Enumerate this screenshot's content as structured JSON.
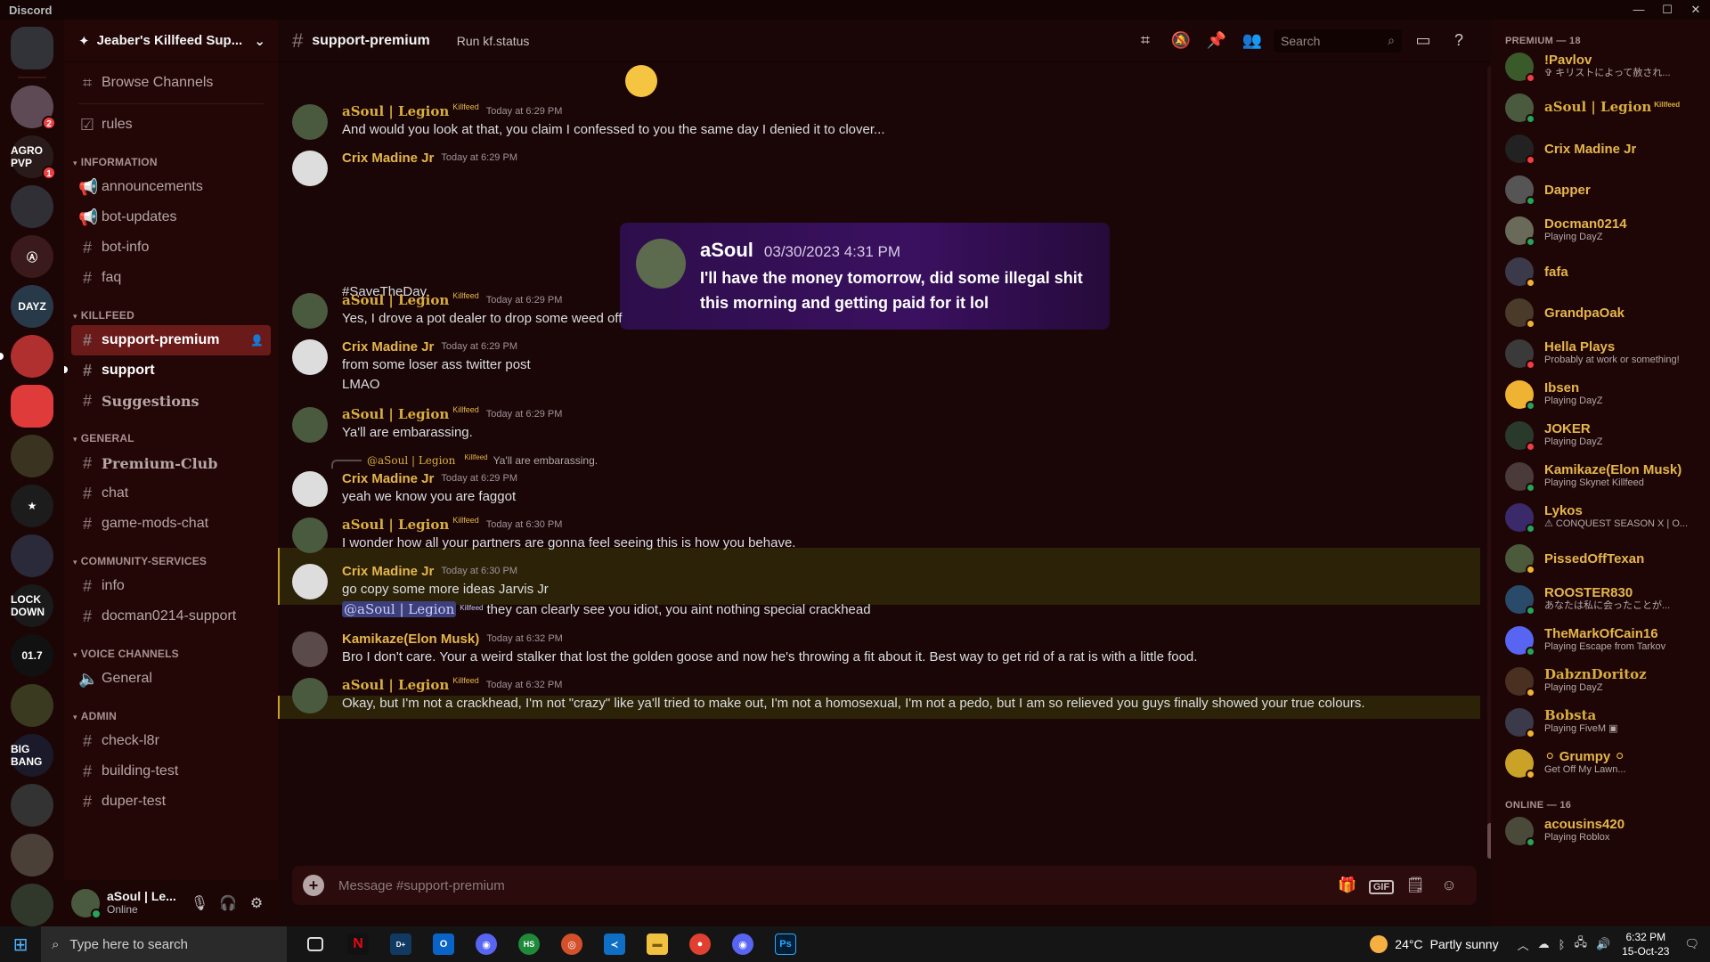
{
  "window": {
    "app_name": "Discord",
    "minimize": "—",
    "maximize": "☐",
    "close": "✕"
  },
  "guilds": [
    {
      "label": "",
      "color": "#313338",
      "kind": "home"
    },
    {
      "label": "",
      "color": "#5d4a54",
      "badge": "2"
    },
    {
      "label": "AGRO PVP",
      "color": "#2a1b1b",
      "badge": "1"
    },
    {
      "label": "",
      "color": "#2f2f35"
    },
    {
      "label": "Ⓐ",
      "color": "#3a1a1a"
    },
    {
      "label": "DAYZ",
      "color": "#283a4a"
    },
    {
      "label": "",
      "color": "#b03030"
    },
    {
      "label": "",
      "color": "#e03b3b",
      "kind": "folder"
    },
    {
      "label": "",
      "color": "#3a3320"
    },
    {
      "label": "★",
      "color": "#1c1c1c"
    },
    {
      "label": "",
      "color": "#2a2a3a"
    },
    {
      "label": "LOCK DOWN",
      "color": "#1a1a1a"
    },
    {
      "label": "01.7",
      "color": "#111"
    },
    {
      "label": "",
      "color": "#3a3a20"
    },
    {
      "label": "BIG BANG",
      "color": "#1a1a2a"
    },
    {
      "label": "",
      "color": "#333"
    },
    {
      "label": "",
      "color": "#4a4038"
    },
    {
      "label": "",
      "color": "#30382c"
    }
  ],
  "server": {
    "name": "Jeaber's Killfeed Sup...",
    "chevron": "⌄"
  },
  "sidebar": {
    "browse": "Browse Channels",
    "rules": "rules",
    "cat_information": "INFORMATION",
    "announcements": "announcements",
    "bot_updates": "bot-updates",
    "bot_info": "bot-info",
    "faq": "faq",
    "cat_killfeed": "KILLFEED",
    "support_premium": "support-premium",
    "support": "support",
    "suggestions": "Suggestions",
    "cat_general": "GENERAL",
    "premium_club": "Premium-Club",
    "chat": "chat",
    "game_mods_chat": "game-mods-chat",
    "cat_community": "COMMUNITY-SERVICES",
    "info": "info",
    "docman_support": "docman0214-support",
    "cat_voice": "VOICE CHANNELS",
    "voice_general": "General",
    "cat_admin": "ADMIN",
    "check_l8r": "check-l8r",
    "building_test": "building-test",
    "duper_test": "duper-test"
  },
  "user_panel": {
    "name": "aSoul | Le...",
    "status": "Online"
  },
  "header": {
    "channel": "support-premium",
    "topic": "Run kf.status",
    "search_placeholder": "Search"
  },
  "messages": [
    {
      "author": "aSoul | Legion",
      "tag": "Killfeed",
      "time": "Today at 6:29 PM",
      "lines": [
        "And would you look at that, you claim I confessed to you the same day I denied it to clover..."
      ]
    },
    {
      "author": "Crix Madine Jr",
      "time": "Today at 6:29 PM",
      "lines": [
        "#SaveTheDay"
      ]
    },
    {
      "author": "aSoul | Legion",
      "tag": "Killfeed",
      "time": "Today at 6:29 PM",
      "lines": [
        "Yes, I drove a pot dealer to drop some weed off"
      ]
    },
    {
      "author": "Crix Madine Jr",
      "time": "Today at 6:29 PM",
      "lines": [
        "from some loser ass twitter post",
        "LMAO"
      ]
    },
    {
      "author": "aSoul | Legion",
      "tag": "Killfeed",
      "time": "Today at 6:29 PM",
      "lines": [
        "Ya'll are embarassing."
      ]
    },
    {
      "author": "Crix Madine Jr",
      "time": "Today at 6:29 PM",
      "lines": [
        "yeah we know you are faggot"
      ],
      "reply_name": "@aSoul | Legion",
      "reply_tag": "Killfeed",
      "reply_text": "Ya'll are embarassing."
    },
    {
      "author": "aSoul | Legion",
      "tag": "Killfeed",
      "time": "Today at 6:30 PM",
      "lines": [
        "I wonder how all your partners are gonna feel seeing this is how you behave."
      ]
    },
    {
      "author": "Crix Madine Jr",
      "time": "Today at 6:30 PM",
      "lines": [
        "go copy some more ideas Jarvis Jr"
      ],
      "mention": "@aSoul | Legion",
      "mention_tag": "Killfeed",
      "mention_text": "they can clearly see you idiot, you aint nothing special crackhead"
    },
    {
      "author": "Kamikaze(Elon Musk)",
      "time": "Today at 6:32 PM",
      "lines": [
        "Bro I don't care. Your a weird stalker that lost the golden goose and now he's throwing a fit about it. Best way to get rid of a rat is with a little food."
      ]
    },
    {
      "author": "aSoul | Legion",
      "tag": "Killfeed",
      "time": "Today at 6:32 PM",
      "lines": [
        "Okay, but I'm not a crackhead, I'm not \"crazy\" like ya'll tried to make out, I'm not a homosexual, I'm not a pedo, but I am so relieved you guys finally showed your true colours."
      ]
    }
  ],
  "embed": {
    "name": "aSoul",
    "time": "03/30/2023 4:31 PM",
    "text": "I'll have the money tomorrow, did some illegal shit this morning and getting paid for it lol"
  },
  "composer": {
    "placeholder": "Message #support-premium",
    "gif": "GIF"
  },
  "members": {
    "premium_header": "PREMIUM — 18",
    "online_header": "ONLINE — 16",
    "premium": [
      {
        "name": "!Pavlov",
        "activity": "✞ キリストによって赦され...",
        "color": "#3a5a2a",
        "status": "#f23f43"
      },
      {
        "name": "aSoul | Legion",
        "tag": "Killfeed",
        "activity": "",
        "color": "#4a5a3e",
        "status": "#23a55a",
        "soul": true
      },
      {
        "name": "Crix Madine Jr",
        "activity": "",
        "color": "#222",
        "status": "#f23f43"
      },
      {
        "name": "Dapper",
        "activity": "",
        "color": "#555",
        "status": "#23a55a"
      },
      {
        "name": "Docman0214",
        "activity": "Playing DayZ",
        "color": "#6a6a5a",
        "status": "#23a55a"
      },
      {
        "name": "fafa",
        "activity": "",
        "color": "#3a3a4a",
        "status": "#f0b232"
      },
      {
        "name": "GrandpaOak",
        "activity": "",
        "color": "#4a3a2a",
        "status": "#f0b232"
      },
      {
        "name": "Hella Plays",
        "activity": "Probably at work or something!",
        "color": "#3a3a3a",
        "status": "#f23f43"
      },
      {
        "name": "Ibsen",
        "activity": "Playing DayZ",
        "color": "#f0b232",
        "status": "#23a55a"
      },
      {
        "name": "JOKER",
        "activity": "Playing DayZ",
        "color": "#2a3a2a",
        "status": "#f23f43"
      },
      {
        "name": "Kamikaze(Elon Musk)",
        "activity": "Playing Skynet Killfeed",
        "color": "#4a3a3a",
        "status": "#23a55a"
      },
      {
        "name": "Lykos",
        "activity": "⚠ CONQUEST SEASON X | O...",
        "color": "#3a2a6a",
        "status": "#23a55a"
      },
      {
        "name": "PissedOffTexan",
        "activity": "",
        "color": "#4a5a3a",
        "status": "#f0b232"
      },
      {
        "name": "ROOSTER830",
        "activity": "あなたは私に会ったことが...",
        "color": "#2a4a6a",
        "status": "#23a55a"
      },
      {
        "name": "TheMarkOfCain16",
        "activity": "Playing Escape from Tarkov",
        "color": "#5865f2",
        "status": "#23a55a"
      },
      {
        "name": "DabznDoritoz",
        "activity": "Playing DayZ",
        "color": "#4a3020",
        "status": "#f0b232",
        "soul": true
      },
      {
        "name": "Bobsta",
        "activity": "Playing FiveM ▣",
        "color": "#3a3a4a",
        "status": "#f0b232",
        "soul": true
      },
      {
        "name": "⚪ Grumpy ⚪",
        "activity": "Get Off My Lawn...",
        "color": "#c9a227",
        "status": "#f0b232"
      }
    ],
    "online": [
      {
        "name": "acousins420",
        "activity": "Playing Roblox",
        "color": "#4a4a3a",
        "status": "#23a55a"
      }
    ]
  },
  "taskbar": {
    "search_placeholder": "Type here to search",
    "temp": "24°C",
    "weather": "Partly sunny",
    "time": "6:32 PM",
    "date": "15-Oct-23"
  }
}
